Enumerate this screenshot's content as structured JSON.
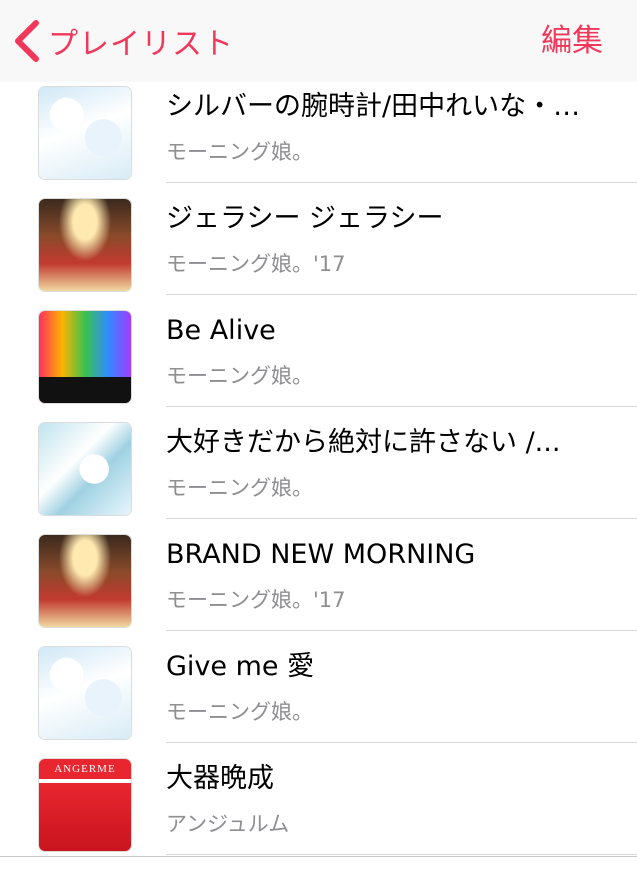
{
  "nav": {
    "back_label": "プレイリスト",
    "edit_label": "編集",
    "accent_color": "#f2385a"
  },
  "songs": [
    {
      "title": "シルバーの腕時計/田中れいな・…",
      "artist": "モーニング娘。"
    },
    {
      "title": "ジェラシー ジェラシー",
      "artist": "モーニング娘。'17"
    },
    {
      "title": "Be Alive",
      "artist": "モーニング娘。"
    },
    {
      "title": "大好きだから絶対に許さない /...",
      "artist": "モーニング娘。"
    },
    {
      "title": "BRAND NEW MORNING",
      "artist": "モーニング娘。'17"
    },
    {
      "title": "Give me 愛",
      "artist": "モーニング娘。"
    },
    {
      "title": "大器晩成",
      "artist": "アンジュルム",
      "art_text": "ANGERME"
    }
  ]
}
